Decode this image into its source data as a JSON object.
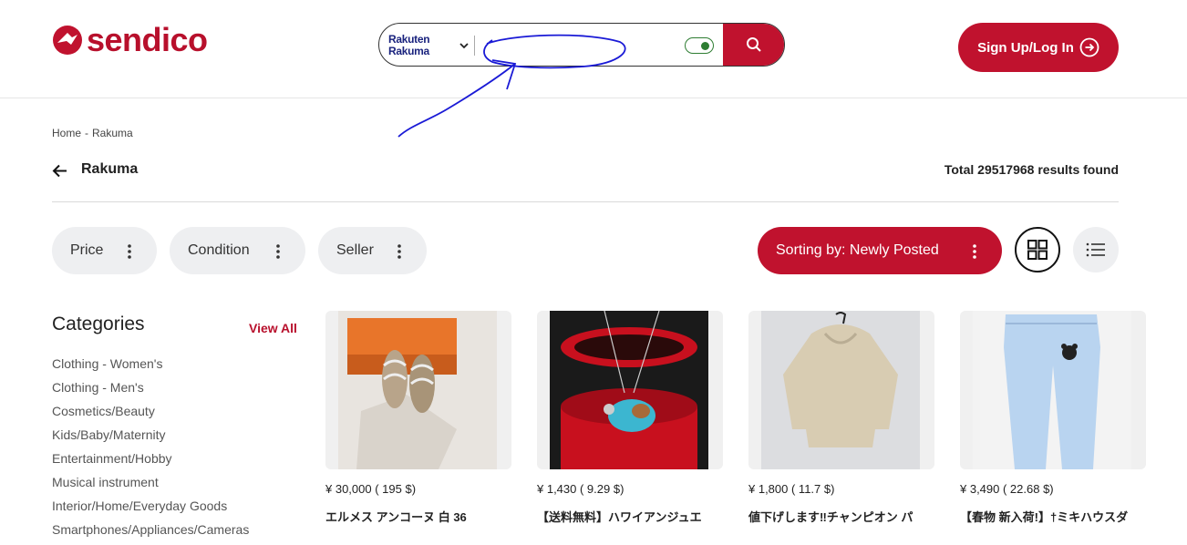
{
  "brand": {
    "name": "sendico",
    "color": "#c0122e"
  },
  "search": {
    "marketplace_line1": "Rakuten",
    "marketplace_line2": "Rakuma",
    "placeholder": "",
    "value": "",
    "toggle_on": true
  },
  "auth": {
    "signup_label": "Sign Up/Log In"
  },
  "breadcrumb": {
    "home": "Home",
    "separator": "-",
    "current": "Rakuma"
  },
  "page": {
    "title": "Rakuma",
    "results_text": "Total 29517968 results found"
  },
  "filters": {
    "price": "Price",
    "condition": "Condition",
    "seller": "Seller"
  },
  "sort": {
    "label": "Sorting by: Newly Posted"
  },
  "categories": {
    "title": "Categories",
    "view_all": "View All",
    "items": [
      "Clothing - Women's",
      "Clothing - Men's",
      "Cosmetics/Beauty",
      "Kids/Baby/Maternity",
      "Entertainment/Hobby",
      "Musical instrument",
      "Interior/Home/Everyday Goods",
      "Smartphones/Appliances/Cameras"
    ]
  },
  "products": [
    {
      "price": "¥ 30,000 ( 195 $)",
      "name": "エルメス アンコーヌ 白 36",
      "image": "sandals-with-orange-box"
    },
    {
      "price": "¥ 1,430 ( 9.29 $)",
      "name": "【送料無料】ハワイアンジュエ",
      "image": "turtle-pendant-necklace"
    },
    {
      "price": "¥ 1,800 ( 11.7 $)",
      "name": "値下げします‼︎チャンピオン パ",
      "image": "beige-hoodie"
    },
    {
      "price": "¥ 3,490 ( 22.68 $)",
      "name": "【春物 新入荷!】†ミキハウスダ",
      "image": "light-blue-jeans"
    }
  ]
}
